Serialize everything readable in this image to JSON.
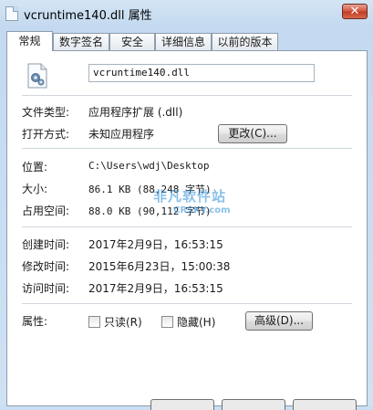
{
  "window": {
    "title": "vcruntime140.dll 属性",
    "close_glyph": "✕"
  },
  "tabs": [
    {
      "label": "常规"
    },
    {
      "label": "数字签名"
    },
    {
      "label": "安全"
    },
    {
      "label": "详细信息"
    },
    {
      "label": "以前的版本"
    }
  ],
  "file": {
    "name": "vcruntime140.dll",
    "icon": "dll-file-gear-icon"
  },
  "fields": {
    "type_label": "文件类型:",
    "type_value": "应用程序扩展 (.dll)",
    "open_label": "打开方式:",
    "open_value": "未知应用程序",
    "change_button": "更改(C)...",
    "location_label": "位置:",
    "location_value": "C:\\Users\\wdj\\Desktop",
    "size_label": "大小:",
    "size_value": "86.1 KB (88,248 字节)",
    "disk_label": "占用空间:",
    "disk_value": "88.0 KB (90,112 字节)",
    "created_label": "创建时间:",
    "created_value": "2017年2月9日，16:53:15",
    "modified_label": "修改时间:",
    "modified_value": "2015年6月23日，15:00:38",
    "accessed_label": "访问时间:",
    "accessed_value": "2017年2月9日，16:53:15",
    "attr_label": "属性:",
    "readonly_label": "只读(R)",
    "hidden_label": "隐藏(H)",
    "advanced_button": "高级(D)..."
  },
  "watermark": {
    "text": "非凡软件站",
    "subtext": "CRSKY.com"
  }
}
